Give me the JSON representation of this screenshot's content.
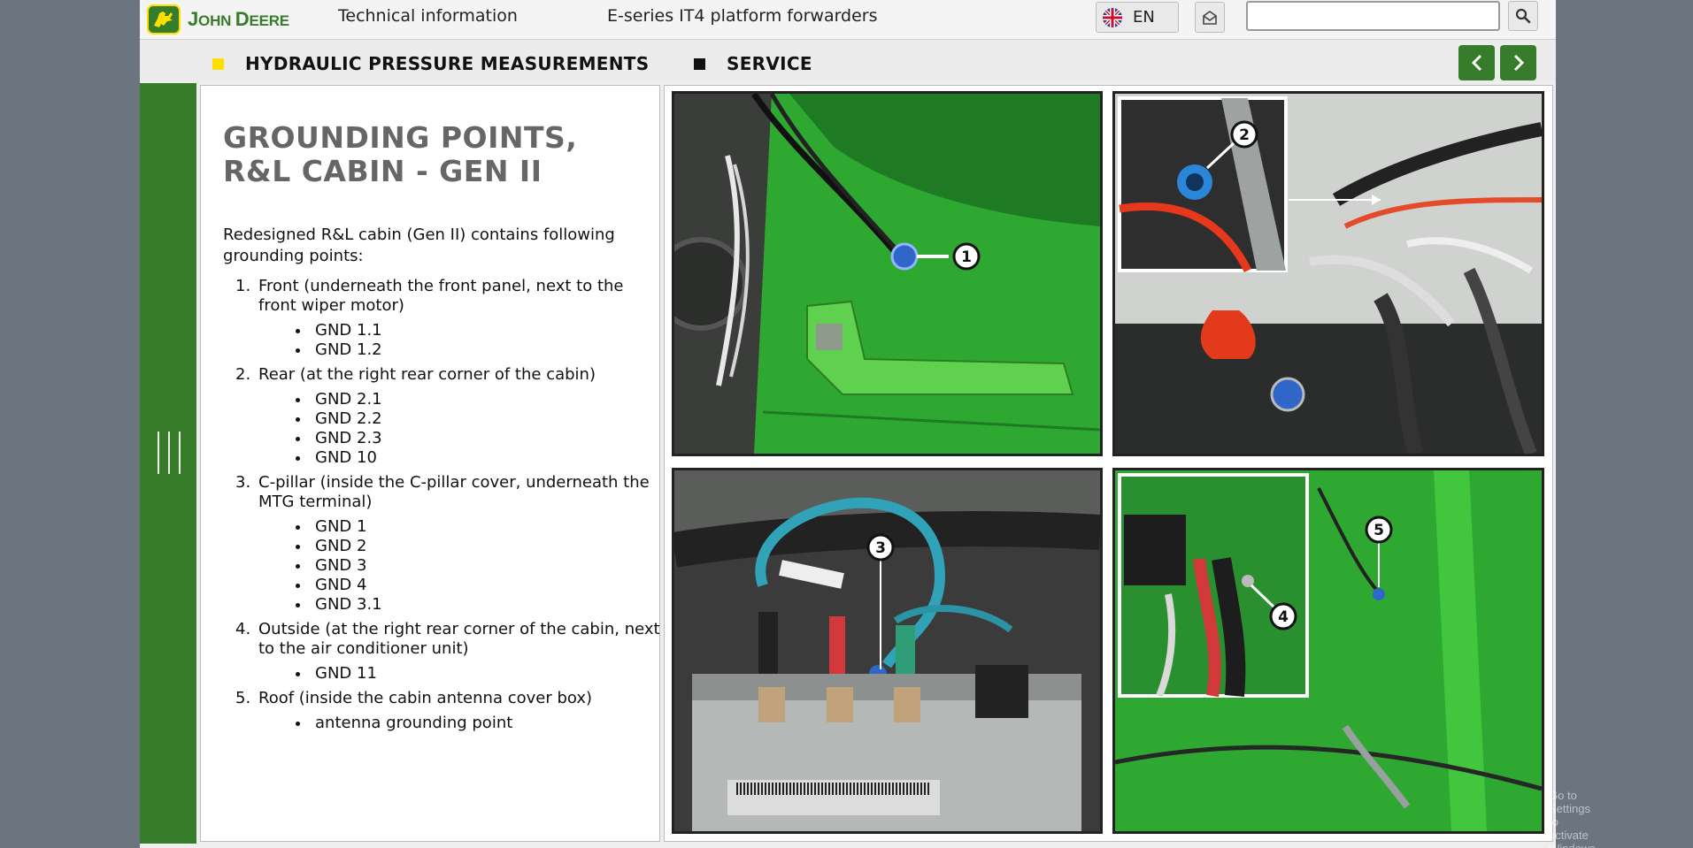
{
  "header": {
    "brand": "JOHN DEERE",
    "brand_a": "J",
    "brand_b": "OHN ",
    "brand_c": "D",
    "brand_d": "EERE",
    "section_link": "Technical information",
    "product_line": "E-series IT4 platform forwarders",
    "language": "EN",
    "search": {
      "value": "",
      "placeholder": ""
    }
  },
  "breadcrumbs": [
    {
      "label": "HYDRAULIC PRESSURE MEASUREMENTS",
      "marker_color": "#ffde00"
    },
    {
      "label": "SERVICE",
      "marker_color": "#111111"
    }
  ],
  "content": {
    "title_line1": "GROUNDING POINTS,",
    "title_line2": "R&L CABIN - GEN II",
    "intro": "Redesigned R&L cabin (Gen II) contains following grounding points:",
    "items": [
      {
        "num": "1.",
        "text": "Front (underneath the front panel, next to the front wiper motor)",
        "subs": [
          "GND 1.1",
          "GND 1.2"
        ]
      },
      {
        "num": "2.",
        "text": "Rear (at the right rear corner of the cabin)",
        "subs": [
          "GND 2.1",
          "GND 2.2",
          "GND 2.3",
          "GND 10"
        ]
      },
      {
        "num": "3.",
        "text": "C-pillar (inside the C-pillar cover, underneath the MTG terminal)",
        "subs": [
          "GND 1",
          "GND 2",
          "GND 3",
          "GND 4",
          "GND 3.1"
        ]
      },
      {
        "num": "4.",
        "text": "Outside (at the right rear corner of the cabin, next to the air conditioner unit)",
        "subs": [
          "GND 11"
        ]
      },
      {
        "num": "5.",
        "text": "Roof (inside the cabin antenna cover box)",
        "subs": [
          "antenna grounding point"
        ]
      }
    ]
  },
  "photos": {
    "callout_1": "1",
    "callout_2": "2",
    "callout_3": "3",
    "callout_4": "4",
    "callout_5": "5"
  },
  "watermark": "Go to Settings to activate Windows.",
  "colors": {
    "brand_green": "#367c2b",
    "brand_yellow": "#ffde00",
    "machine_green": "#2fa832"
  },
  "icons": [
    "deer-logo-icon",
    "uk-flag-icon",
    "mail-icon",
    "search-icon",
    "chevron-left-icon",
    "chevron-right-icon",
    "sidebar-handle-icon"
  ]
}
